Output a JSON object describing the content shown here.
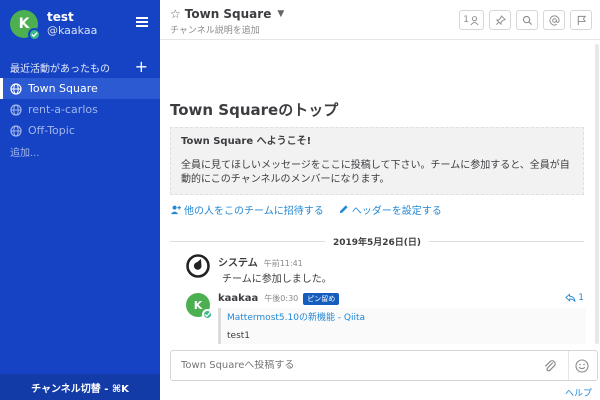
{
  "user": {
    "avatar_letter": "K",
    "name": "test",
    "handle": "@kaakaa"
  },
  "sidebar": {
    "section_title": "最近活動があったもの",
    "channels": [
      {
        "label": "Town Square",
        "active": true
      },
      {
        "label": "rent-a-carlos",
        "active": false
      },
      {
        "label": "Off-Topic",
        "active": false
      }
    ],
    "more_label": "追加...",
    "switcher_label": "チャンネル切替 - ⌘K"
  },
  "header": {
    "channel_name": "Town Square",
    "purpose_placeholder": "チャンネル説明を追加",
    "member_count": "1"
  },
  "intro": {
    "title": "Town Squareのトップ",
    "welcome": "Town Square へようこそ!",
    "description": "全員に見てほしいメッセージをここに投稿して下さい。チームに参加すると、全員が自動的にこのチャンネルのメンバーになります。",
    "invite_link": "他の人をこのチームに招待する",
    "header_link": "ヘッダーを設定する"
  },
  "date_separator": "2019年5月26日(日)",
  "posts": [
    {
      "author": "システム",
      "time": "午前11:41",
      "message": "チームに参加しました。"
    },
    {
      "author": "kaakaa",
      "avatar_letter": "K",
      "time": "午後0:30",
      "badge": "ピン留め",
      "reply_count": "1",
      "attachment_link": "Mattermost5.10の新機能 - Qiita",
      "attachment_text": "test1"
    }
  ],
  "composer": {
    "placeholder": "Town Squareへ投稿する"
  },
  "help_label": "ヘルプ",
  "colors": {
    "sidebar_bg": "#1543c4",
    "link": "#2389d7",
    "online": "#3db887",
    "avatar": "#4caf50"
  }
}
